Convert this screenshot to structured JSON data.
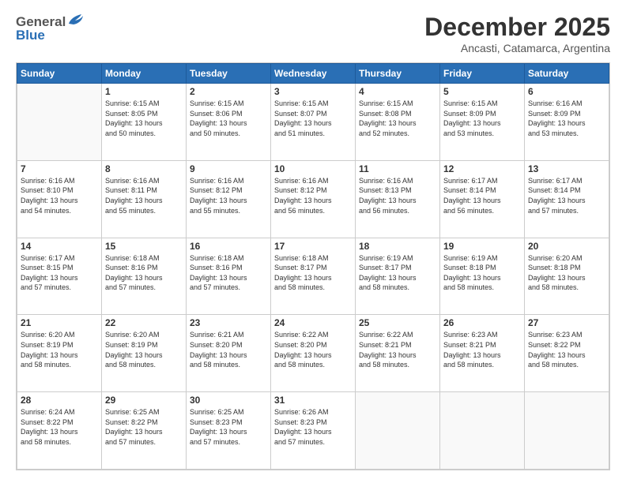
{
  "header": {
    "logo_general": "General",
    "logo_blue": "Blue",
    "month_title": "December 2025",
    "subtitle": "Ancasti, Catamarca, Argentina"
  },
  "weekdays": [
    "Sunday",
    "Monday",
    "Tuesday",
    "Wednesday",
    "Thursday",
    "Friday",
    "Saturday"
  ],
  "weeks": [
    [
      {
        "day": "",
        "info": ""
      },
      {
        "day": "1",
        "info": "Sunrise: 6:15 AM\nSunset: 8:05 PM\nDaylight: 13 hours\nand 50 minutes."
      },
      {
        "day": "2",
        "info": "Sunrise: 6:15 AM\nSunset: 8:06 PM\nDaylight: 13 hours\nand 50 minutes."
      },
      {
        "day": "3",
        "info": "Sunrise: 6:15 AM\nSunset: 8:07 PM\nDaylight: 13 hours\nand 51 minutes."
      },
      {
        "day": "4",
        "info": "Sunrise: 6:15 AM\nSunset: 8:08 PM\nDaylight: 13 hours\nand 52 minutes."
      },
      {
        "day": "5",
        "info": "Sunrise: 6:15 AM\nSunset: 8:09 PM\nDaylight: 13 hours\nand 53 minutes."
      },
      {
        "day": "6",
        "info": "Sunrise: 6:16 AM\nSunset: 8:09 PM\nDaylight: 13 hours\nand 53 minutes."
      }
    ],
    [
      {
        "day": "7",
        "info": "Sunrise: 6:16 AM\nSunset: 8:10 PM\nDaylight: 13 hours\nand 54 minutes."
      },
      {
        "day": "8",
        "info": "Sunrise: 6:16 AM\nSunset: 8:11 PM\nDaylight: 13 hours\nand 55 minutes."
      },
      {
        "day": "9",
        "info": "Sunrise: 6:16 AM\nSunset: 8:12 PM\nDaylight: 13 hours\nand 55 minutes."
      },
      {
        "day": "10",
        "info": "Sunrise: 6:16 AM\nSunset: 8:12 PM\nDaylight: 13 hours\nand 56 minutes."
      },
      {
        "day": "11",
        "info": "Sunrise: 6:16 AM\nSunset: 8:13 PM\nDaylight: 13 hours\nand 56 minutes."
      },
      {
        "day": "12",
        "info": "Sunrise: 6:17 AM\nSunset: 8:14 PM\nDaylight: 13 hours\nand 56 minutes."
      },
      {
        "day": "13",
        "info": "Sunrise: 6:17 AM\nSunset: 8:14 PM\nDaylight: 13 hours\nand 57 minutes."
      }
    ],
    [
      {
        "day": "14",
        "info": "Sunrise: 6:17 AM\nSunset: 8:15 PM\nDaylight: 13 hours\nand 57 minutes."
      },
      {
        "day": "15",
        "info": "Sunrise: 6:18 AM\nSunset: 8:16 PM\nDaylight: 13 hours\nand 57 minutes."
      },
      {
        "day": "16",
        "info": "Sunrise: 6:18 AM\nSunset: 8:16 PM\nDaylight: 13 hours\nand 57 minutes."
      },
      {
        "day": "17",
        "info": "Sunrise: 6:18 AM\nSunset: 8:17 PM\nDaylight: 13 hours\nand 58 minutes."
      },
      {
        "day": "18",
        "info": "Sunrise: 6:19 AM\nSunset: 8:17 PM\nDaylight: 13 hours\nand 58 minutes."
      },
      {
        "day": "19",
        "info": "Sunrise: 6:19 AM\nSunset: 8:18 PM\nDaylight: 13 hours\nand 58 minutes."
      },
      {
        "day": "20",
        "info": "Sunrise: 6:20 AM\nSunset: 8:18 PM\nDaylight: 13 hours\nand 58 minutes."
      }
    ],
    [
      {
        "day": "21",
        "info": "Sunrise: 6:20 AM\nSunset: 8:19 PM\nDaylight: 13 hours\nand 58 minutes."
      },
      {
        "day": "22",
        "info": "Sunrise: 6:20 AM\nSunset: 8:19 PM\nDaylight: 13 hours\nand 58 minutes."
      },
      {
        "day": "23",
        "info": "Sunrise: 6:21 AM\nSunset: 8:20 PM\nDaylight: 13 hours\nand 58 minutes."
      },
      {
        "day": "24",
        "info": "Sunrise: 6:22 AM\nSunset: 8:20 PM\nDaylight: 13 hours\nand 58 minutes."
      },
      {
        "day": "25",
        "info": "Sunrise: 6:22 AM\nSunset: 8:21 PM\nDaylight: 13 hours\nand 58 minutes."
      },
      {
        "day": "26",
        "info": "Sunrise: 6:23 AM\nSunset: 8:21 PM\nDaylight: 13 hours\nand 58 minutes."
      },
      {
        "day": "27",
        "info": "Sunrise: 6:23 AM\nSunset: 8:22 PM\nDaylight: 13 hours\nand 58 minutes."
      }
    ],
    [
      {
        "day": "28",
        "info": "Sunrise: 6:24 AM\nSunset: 8:22 PM\nDaylight: 13 hours\nand 58 minutes."
      },
      {
        "day": "29",
        "info": "Sunrise: 6:25 AM\nSunset: 8:22 PM\nDaylight: 13 hours\nand 57 minutes."
      },
      {
        "day": "30",
        "info": "Sunrise: 6:25 AM\nSunset: 8:23 PM\nDaylight: 13 hours\nand 57 minutes."
      },
      {
        "day": "31",
        "info": "Sunrise: 6:26 AM\nSunset: 8:23 PM\nDaylight: 13 hours\nand 57 minutes."
      },
      {
        "day": "",
        "info": ""
      },
      {
        "day": "",
        "info": ""
      },
      {
        "day": "",
        "info": ""
      }
    ]
  ]
}
